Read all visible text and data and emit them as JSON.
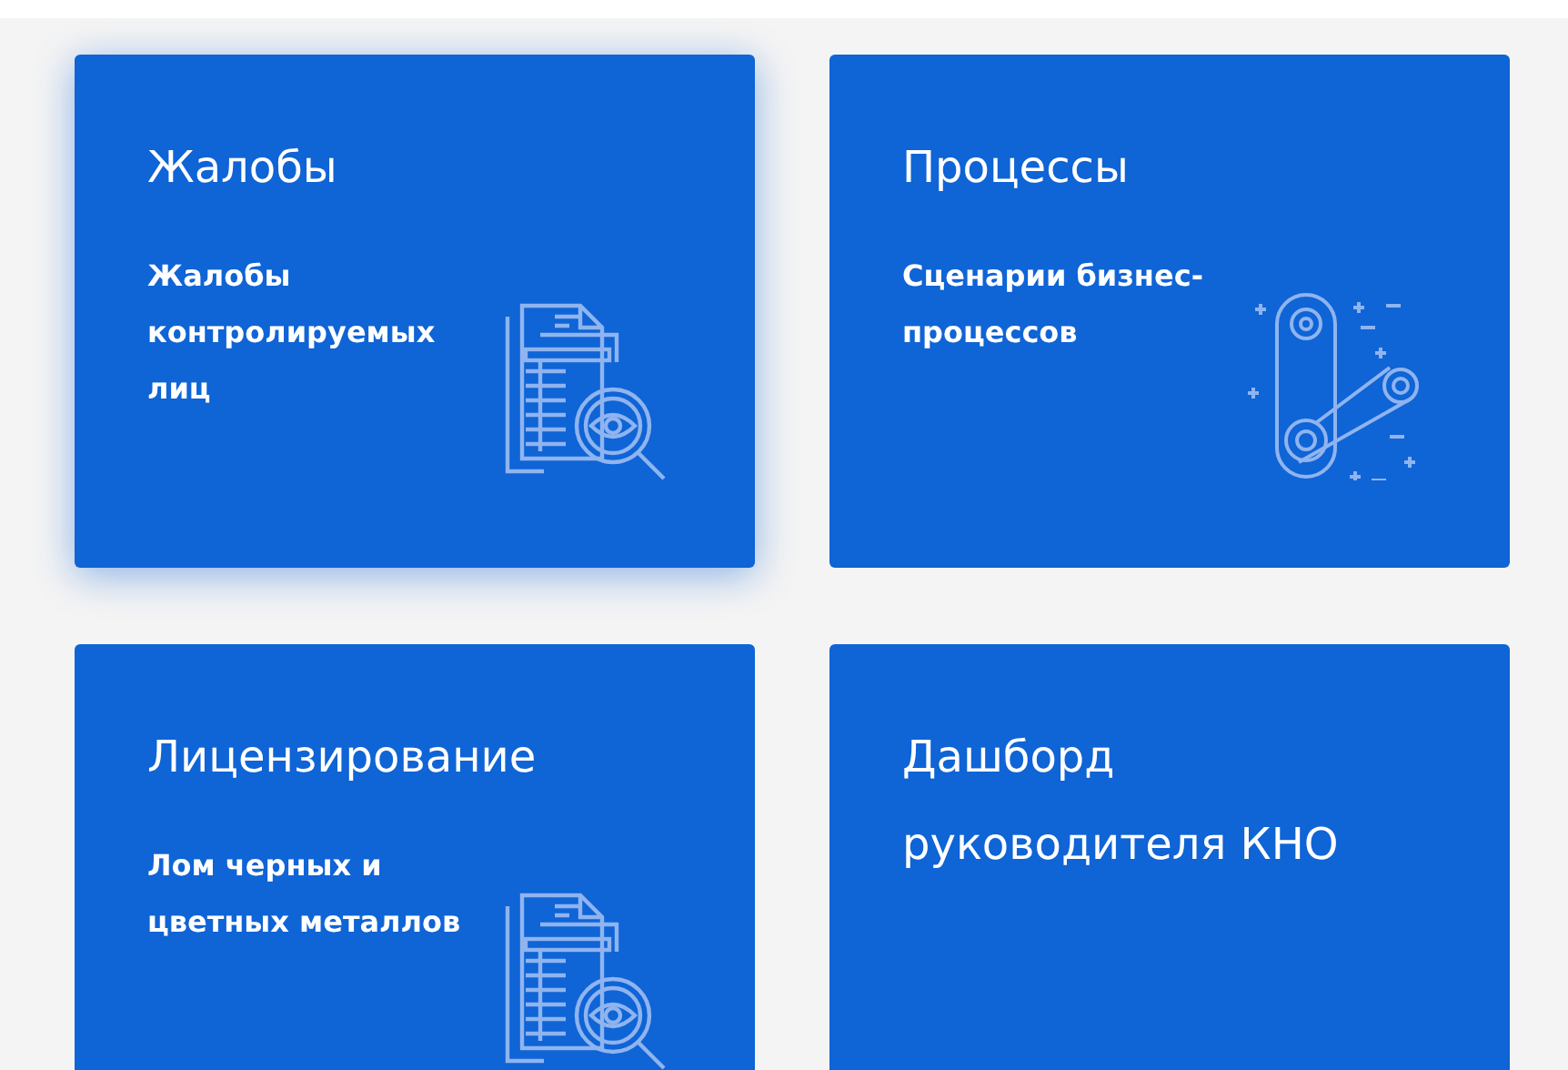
{
  "cards": [
    {
      "title": "Жалобы",
      "description": "Жалобы контролируемых лиц",
      "kind": "document-search",
      "highlighted": true
    },
    {
      "title": "Процессы",
      "description": "Сценарии бизнес-процессов",
      "kind": "gears",
      "highlighted": false
    },
    {
      "title": "Лицензирование",
      "description": "Лом черных и цветных металлов",
      "kind": "document-search",
      "highlighted": false
    },
    {
      "title": "Дашборд руководителя КНО",
      "kind": "plain",
      "highlighted": false
    }
  ]
}
